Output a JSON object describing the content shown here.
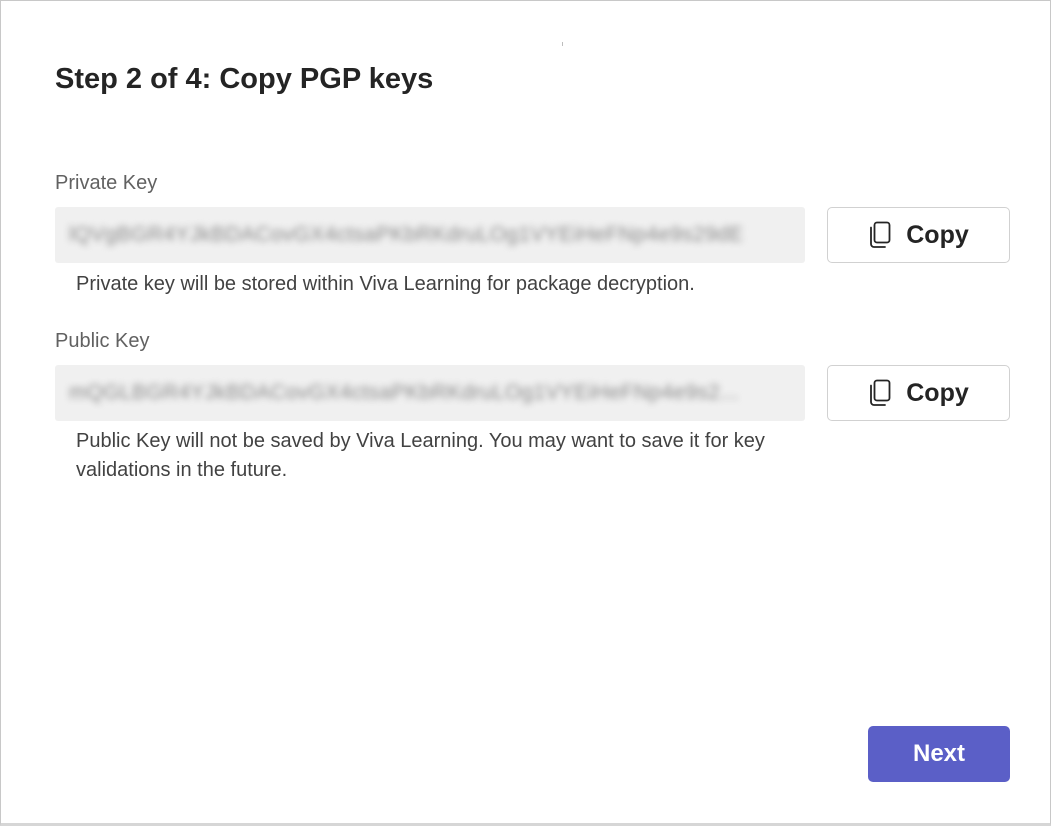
{
  "dialog": {
    "title": "Step 2 of 4: Copy PGP keys"
  },
  "private_key": {
    "label": "Private Key",
    "value": "lQVgBGR4YJkBDACovGX4ctsaPKbRKdruLOg1VYEiHeFNp4e9s29dE",
    "helper": "Private key will be stored within Viva Learning for package decryption.",
    "copy_label": "Copy",
    "icon": "copy-icon"
  },
  "public_key": {
    "label": "Public Key",
    "value": "mQGLBGR4YJkBDACovGX4ctsaPKbRKdruLOg1VYEiHeFNp4e9s2...",
    "helper": "Public Key will not be saved by Viva Learning. You may want to save it for key validations in the future.",
    "copy_label": "Copy",
    "icon": "copy-icon"
  },
  "footer": {
    "next_label": "Next"
  },
  "colors": {
    "accent": "#5b5fc7",
    "field_background": "#f0f0f0",
    "text_primary": "#242424",
    "text_secondary": "#616161"
  }
}
